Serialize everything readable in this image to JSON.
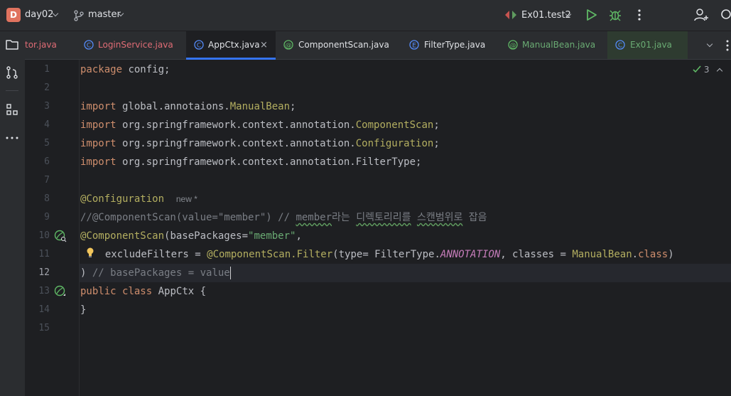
{
  "titlebar": {
    "project_badge": "D",
    "project_name": "day02",
    "branch_name": "master",
    "run_config": "Ex01.test2"
  },
  "tabs": [
    {
      "label": "tor.java",
      "icon": "class-icon",
      "color": "#e06c75"
    },
    {
      "label": "LoginService.java",
      "icon": "class-icon",
      "color": "#e06c75"
    },
    {
      "label": "AppCtx.java",
      "icon": "class-icon",
      "color": "#dfe1e5",
      "active": true
    },
    {
      "label": "ComponentScan.java",
      "icon": "annotation-icon",
      "color": "#dfe1e5"
    },
    {
      "label": "FilterType.java",
      "icon": "enum-icon",
      "color": "#dfe1e5"
    },
    {
      "label": "ManualBean.java",
      "icon": "annotation-icon",
      "color": "#6aab73"
    },
    {
      "label": "Ex01.java",
      "icon": "class-icon",
      "color": "#6aab73"
    }
  ],
  "editor": {
    "inspection_count": "3",
    "line_numbers": [
      "1",
      "2",
      "3",
      "4",
      "5",
      "6",
      "7",
      "8",
      "9",
      "10",
      "11",
      "12",
      "13",
      "14",
      "15"
    ],
    "current_line": "12",
    "code": {
      "l1_kw": "package",
      "l1_rest": " config;",
      "l3_kw": "import",
      "l3_pkg": " global.annotaions.",
      "l3_cls": "ManualBean",
      "l3_end": ";",
      "l4_kw": "import",
      "l4_pkg": " org.springframework.context.annotation.",
      "l4_cls": "ComponentScan",
      "l4_end": ";",
      "l5_kw": "import",
      "l5_pkg": " org.springframework.context.annotation.",
      "l5_cls": "Configuration",
      "l5_end": ";",
      "l6_kw": "import",
      "l6_rest": " org.springframework.context.annotation.FilterType;",
      "l8_ann": "@Configuration",
      "l8_hint": "new *",
      "l9_a": "//@ComponentScan(value=\"member\") // ",
      "l9_b": "member",
      "l9_c": "라는 ",
      "l9_d": "디렉토리리를",
      "l9_e": " ",
      "l9_f": "스캔범위로",
      "l9_g": " 잡음",
      "l10_ann": "@ComponentScan",
      "l10_a": "(basePackages=",
      "l10_str": "\"member\"",
      "l10_b": ",",
      "l11_a": "  excludeFilters = ",
      "l11_ann": "@ComponentScan.Filter",
      "l11_b": "(type= FilterType.",
      "l11_it": "ANNOTATION",
      "l11_c": ", classes = ",
      "l11_cls": "ManualBean",
      "l11_d": ".",
      "l11_kw": "class",
      "l11_e": ")",
      "l12_a": ") ",
      "l12_cmt": "// basePackages = value",
      "l13_kw1": "public",
      "l13_sp": " ",
      "l13_kw2": "class",
      "l13_rest": " AppCtx {",
      "l14": "}"
    }
  }
}
